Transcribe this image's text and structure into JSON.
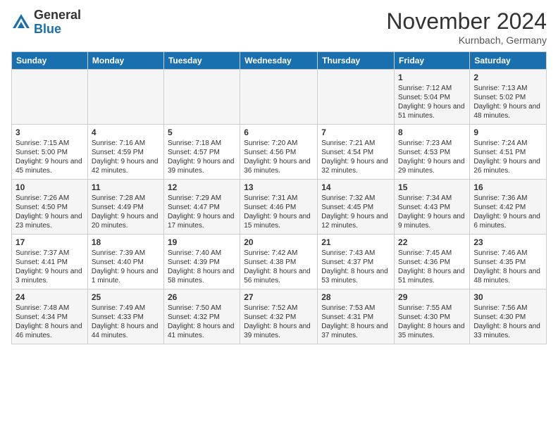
{
  "header": {
    "logo_general": "General",
    "logo_blue": "Blue",
    "title": "November 2024",
    "location": "Kurnbach, Germany"
  },
  "days_of_week": [
    "Sunday",
    "Monday",
    "Tuesday",
    "Wednesday",
    "Thursday",
    "Friday",
    "Saturday"
  ],
  "weeks": [
    [
      {
        "day": "",
        "info": ""
      },
      {
        "day": "",
        "info": ""
      },
      {
        "day": "",
        "info": ""
      },
      {
        "day": "",
        "info": ""
      },
      {
        "day": "",
        "info": ""
      },
      {
        "day": "1",
        "info": "Sunrise: 7:12 AM\nSunset: 5:04 PM\nDaylight: 9 hours and 51 minutes."
      },
      {
        "day": "2",
        "info": "Sunrise: 7:13 AM\nSunset: 5:02 PM\nDaylight: 9 hours and 48 minutes."
      }
    ],
    [
      {
        "day": "3",
        "info": "Sunrise: 7:15 AM\nSunset: 5:00 PM\nDaylight: 9 hours and 45 minutes."
      },
      {
        "day": "4",
        "info": "Sunrise: 7:16 AM\nSunset: 4:59 PM\nDaylight: 9 hours and 42 minutes."
      },
      {
        "day": "5",
        "info": "Sunrise: 7:18 AM\nSunset: 4:57 PM\nDaylight: 9 hours and 39 minutes."
      },
      {
        "day": "6",
        "info": "Sunrise: 7:20 AM\nSunset: 4:56 PM\nDaylight: 9 hours and 36 minutes."
      },
      {
        "day": "7",
        "info": "Sunrise: 7:21 AM\nSunset: 4:54 PM\nDaylight: 9 hours and 32 minutes."
      },
      {
        "day": "8",
        "info": "Sunrise: 7:23 AM\nSunset: 4:53 PM\nDaylight: 9 hours and 29 minutes."
      },
      {
        "day": "9",
        "info": "Sunrise: 7:24 AM\nSunset: 4:51 PM\nDaylight: 9 hours and 26 minutes."
      }
    ],
    [
      {
        "day": "10",
        "info": "Sunrise: 7:26 AM\nSunset: 4:50 PM\nDaylight: 9 hours and 23 minutes."
      },
      {
        "day": "11",
        "info": "Sunrise: 7:28 AM\nSunset: 4:49 PM\nDaylight: 9 hours and 20 minutes."
      },
      {
        "day": "12",
        "info": "Sunrise: 7:29 AM\nSunset: 4:47 PM\nDaylight: 9 hours and 17 minutes."
      },
      {
        "day": "13",
        "info": "Sunrise: 7:31 AM\nSunset: 4:46 PM\nDaylight: 9 hours and 15 minutes."
      },
      {
        "day": "14",
        "info": "Sunrise: 7:32 AM\nSunset: 4:45 PM\nDaylight: 9 hours and 12 minutes."
      },
      {
        "day": "15",
        "info": "Sunrise: 7:34 AM\nSunset: 4:43 PM\nDaylight: 9 hours and 9 minutes."
      },
      {
        "day": "16",
        "info": "Sunrise: 7:36 AM\nSunset: 4:42 PM\nDaylight: 9 hours and 6 minutes."
      }
    ],
    [
      {
        "day": "17",
        "info": "Sunrise: 7:37 AM\nSunset: 4:41 PM\nDaylight: 9 hours and 3 minutes."
      },
      {
        "day": "18",
        "info": "Sunrise: 7:39 AM\nSunset: 4:40 PM\nDaylight: 9 hours and 1 minute."
      },
      {
        "day": "19",
        "info": "Sunrise: 7:40 AM\nSunset: 4:39 PM\nDaylight: 8 hours and 58 minutes."
      },
      {
        "day": "20",
        "info": "Sunrise: 7:42 AM\nSunset: 4:38 PM\nDaylight: 8 hours and 56 minutes."
      },
      {
        "day": "21",
        "info": "Sunrise: 7:43 AM\nSunset: 4:37 PM\nDaylight: 8 hours and 53 minutes."
      },
      {
        "day": "22",
        "info": "Sunrise: 7:45 AM\nSunset: 4:36 PM\nDaylight: 8 hours and 51 minutes."
      },
      {
        "day": "23",
        "info": "Sunrise: 7:46 AM\nSunset: 4:35 PM\nDaylight: 8 hours and 48 minutes."
      }
    ],
    [
      {
        "day": "24",
        "info": "Sunrise: 7:48 AM\nSunset: 4:34 PM\nDaylight: 8 hours and 46 minutes."
      },
      {
        "day": "25",
        "info": "Sunrise: 7:49 AM\nSunset: 4:33 PM\nDaylight: 8 hours and 44 minutes."
      },
      {
        "day": "26",
        "info": "Sunrise: 7:50 AM\nSunset: 4:32 PM\nDaylight: 8 hours and 41 minutes."
      },
      {
        "day": "27",
        "info": "Sunrise: 7:52 AM\nSunset: 4:32 PM\nDaylight: 8 hours and 39 minutes."
      },
      {
        "day": "28",
        "info": "Sunrise: 7:53 AM\nSunset: 4:31 PM\nDaylight: 8 hours and 37 minutes."
      },
      {
        "day": "29",
        "info": "Sunrise: 7:55 AM\nSunset: 4:30 PM\nDaylight: 8 hours and 35 minutes."
      },
      {
        "day": "30",
        "info": "Sunrise: 7:56 AM\nSunset: 4:30 PM\nDaylight: 8 hours and 33 minutes."
      }
    ]
  ]
}
